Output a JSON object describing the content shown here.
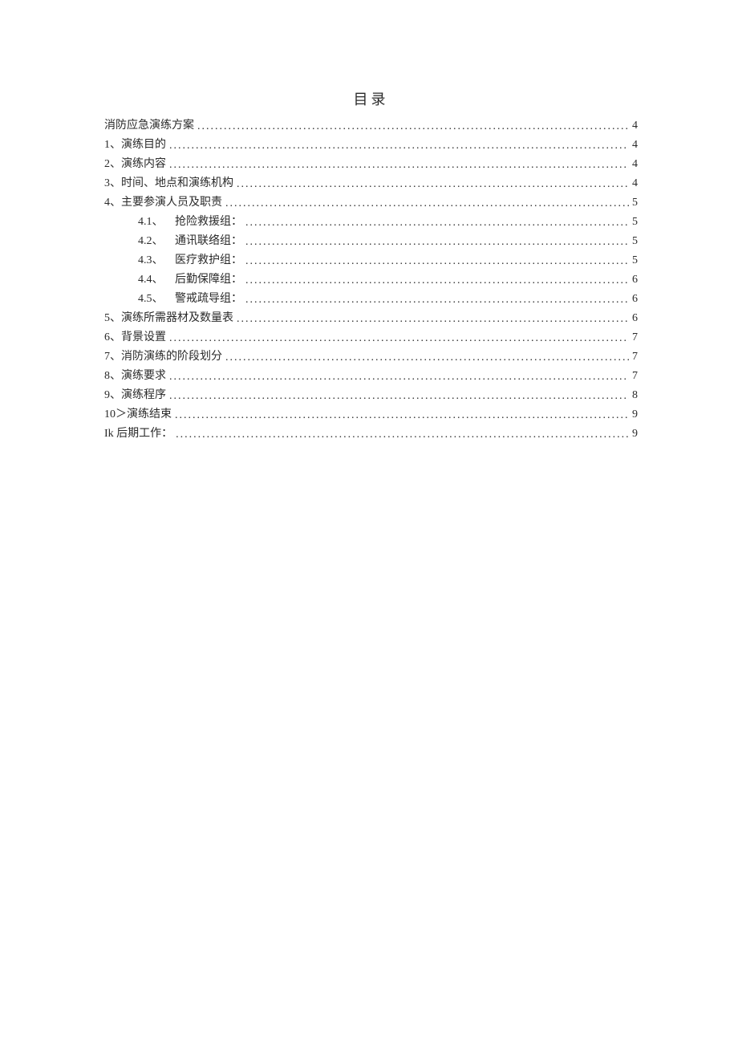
{
  "title": "目录",
  "entries": [
    {
      "label": "消防应急演练方案",
      "page": "4",
      "level": 0
    },
    {
      "label": "1、演练目的",
      "page": "4",
      "level": 0
    },
    {
      "label": "2、演练内容",
      "page": "4",
      "level": 0
    },
    {
      "label": "3、时间、地点和演练机构",
      "page": "4",
      "level": 0
    },
    {
      "label": "4、主要参演人员及职责",
      "page": "5",
      "level": 0
    },
    {
      "num": "4.1、",
      "label": "抢险救援组：",
      "page": "5",
      "level": 1
    },
    {
      "num": "4.2、",
      "label": "通讯联络组：",
      "page": "5",
      "level": 1
    },
    {
      "num": "4.3、",
      "label": "医疗救护组：",
      "page": "5",
      "level": 1
    },
    {
      "num": "4.4、",
      "label": "后勤保障组：",
      "page": "6",
      "level": 1
    },
    {
      "num": "4.5、",
      "label": "警戒疏导组：",
      "page": "6",
      "level": 1
    },
    {
      "label": "5、演练所需器材及数量表",
      "page": "6",
      "level": 0
    },
    {
      "label": "6、背景设置",
      "page": "7",
      "level": 0
    },
    {
      "label": "7、消防演练的阶段划分",
      "page": "7",
      "level": 0
    },
    {
      "label": "8、演练要求",
      "page": "7",
      "level": 0
    },
    {
      "label": "9、演练程序",
      "page": "8",
      "level": 0
    },
    {
      "label": "10＞演练结束",
      "page": "9",
      "level": 0
    },
    {
      "label": "Ik 后期工作：",
      "page": "9",
      "level": 0
    }
  ]
}
